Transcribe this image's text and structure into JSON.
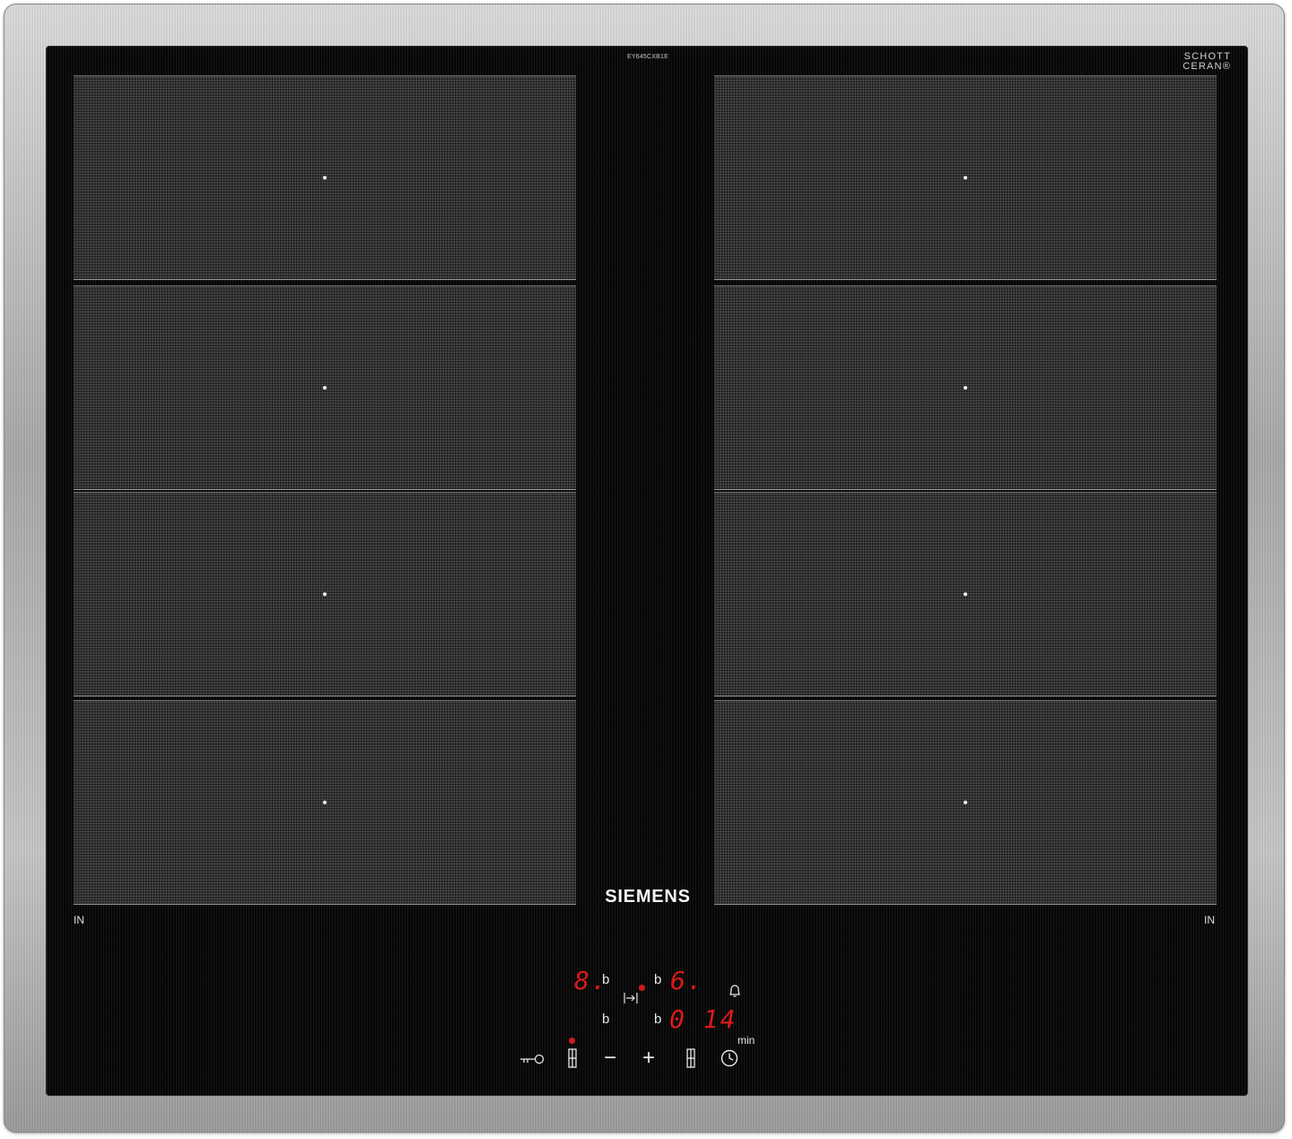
{
  "hob": {
    "model_code": "EY645CXB1E",
    "glass_badge": {
      "line1": "SCHOTT",
      "line2": "CERAN®"
    },
    "brand": "SIEMENS",
    "left_zone_label": "IN",
    "right_zone_label": "IN"
  },
  "display": {
    "left_power": "8.",
    "left_indicator_top": "b",
    "left_indicator_bottom": "b",
    "right_indicator_top": "b",
    "right_indicator_bottom": "b",
    "right_power": "6.",
    "timer_value": "0 14",
    "timer_unit": "min"
  },
  "controls": {
    "minus_label": "−",
    "plus_label": "+"
  },
  "icons": [
    "key-lock-icon",
    "zone-select-icon",
    "minus-icon",
    "plus-icon",
    "bell-icon",
    "clock-icon",
    "move-right-icon"
  ],
  "colors": {
    "display_red": "#e01616",
    "glass": "#060606",
    "frame": "#b4b4b4"
  }
}
